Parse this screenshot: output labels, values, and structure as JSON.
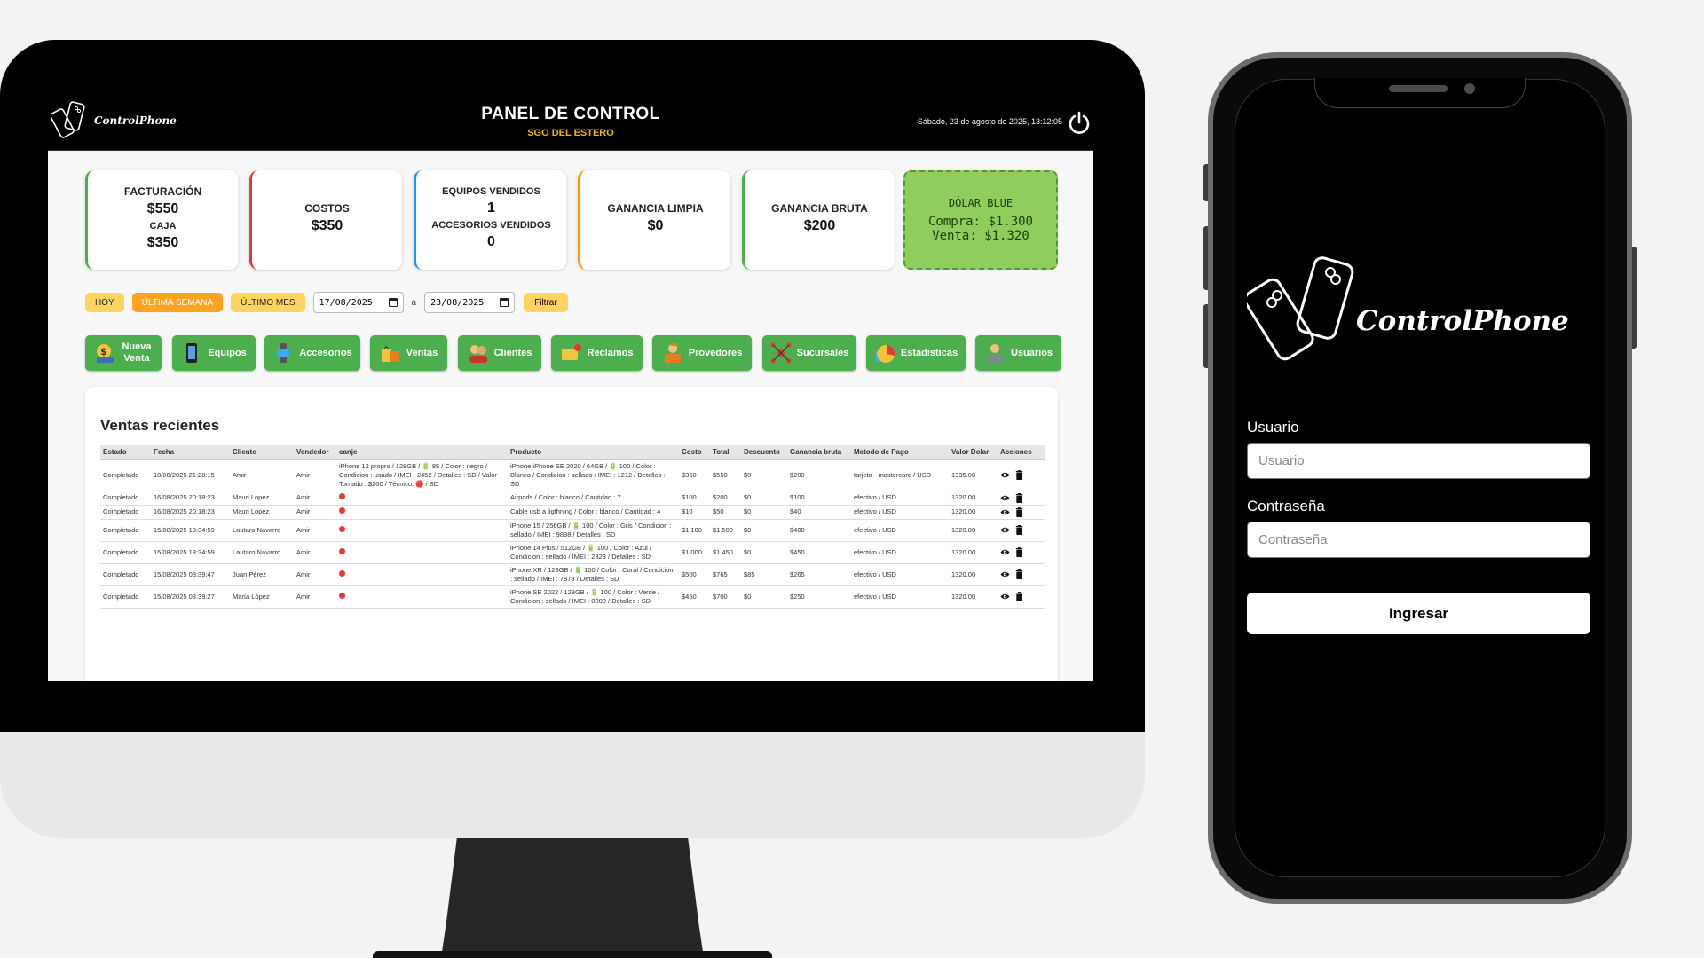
{
  "dashboard": {
    "brand": "ControlPhone",
    "title": "PANEL DE CONTROL",
    "subtitle": "SGO DEL ESTERO",
    "datetime": "Sábado, 23 de agosto de 2025, 13:12:05",
    "stats": {
      "facturacion_label": "FACTURACIÓN",
      "facturacion_value": "$550",
      "caja_label": "CAJA",
      "caja_value": "$350",
      "costos_label": "COSTOS",
      "costos_value": "$350",
      "equipos_label": "EQUIPOS VENDIDOS",
      "equipos_value": "1",
      "accesorios_label": "ACCESORIOS VENDIDOS",
      "accesorios_value": "0",
      "limpia_label": "GANANCIA LIMPIA",
      "limpia_value": "$0",
      "bruta_label": "GANANCIA BRUTA",
      "bruta_value": "$200"
    },
    "dolar": {
      "title": "DÓLAR BLUE",
      "compra": "Compra: $1.300",
      "venta": "Venta: $1.320"
    },
    "filters": {
      "hoy": "HOY",
      "semana": "ÚLTIMA SEMANA",
      "mes": "ÚLTIMO MES",
      "from": "17/08/2025",
      "sep": "a",
      "to": "23/08/2025",
      "filtrar": "Filtrar"
    },
    "nav": {
      "nueva_1": "Nueva",
      "nueva_2": "Venta",
      "equipos": "Equipos",
      "accesorios": "Accesorios",
      "ventas": "Ventas",
      "clientes": "Clientes",
      "reclamos": "Reclamos",
      "proveedores": "Provedores",
      "sucursales": "Sucursales",
      "estadisticas": "Estadisticas",
      "usuarios": "Usuarios"
    },
    "sales_title": "Ventas recientes",
    "columns": [
      "Estado",
      "Fecha",
      "Cliente",
      "Vendedor",
      "canje",
      "Producto",
      "Costo",
      "Total",
      "Descuento",
      "Ganancia bruta",
      "Metodo de Pago",
      "Valor Dolar",
      "Acciones"
    ],
    "rows": [
      [
        "Completado",
        "18/08/2025 21:28:15",
        "Amir",
        "Amir",
        "iPhone 12 propro / 128GB / 🔋 85 / Color : negro / Condicion : usado / IMEI : 2452 / Detalles : SD / Valor Tomado : $200 / Técnico: 🔴 / SD",
        "iPhone iPhone SE 2020 / 64GB / 🔋 100 / Color : Blanco / Condicion : sellado / IMEI : 1212 / Detalles : SD",
        "$350",
        "$550",
        "$0",
        "$200",
        "tarjeta - mastercard / USD",
        "1335.00"
      ],
      [
        "Completado",
        "16/08/2025 20:18:23",
        "Mauri Lopez",
        "Amir",
        "",
        "Airpods / Color : blanco / Cantidad : 7",
        "$100",
        "$200",
        "$0",
        "$100",
        "efectivo / USD",
        "1320.00"
      ],
      [
        "Completado",
        "16/08/2025 20:18:23",
        "Mauri Lopez",
        "Amir",
        "",
        "Cable usb a ligthning / Color : blanco / Cantidad : 4",
        "$10",
        "$50",
        "$0",
        "$40",
        "efectivo / USD",
        "1320.00"
      ],
      [
        "Completado",
        "15/08/2025 13:34:59",
        "Lautaro Navarro",
        "Amir",
        "",
        "iPhone 15 / 256GB / 🔋 100 / Color : Gris / Condicion : sellado / IMEI : 9898 / Detalles : SD",
        "$1.100",
        "$1.500",
        "$0",
        "$400",
        "efectivo / USD",
        "1320.00"
      ],
      [
        "Completado",
        "15/08/2025 13:34:59",
        "Lautaro Navarro",
        "Amir",
        "",
        "iPhone 14 Plus / 512GB / 🔋 100 / Color : Azul / Condicion : sellado / IMEI : 2323 / Detalles : SD",
        "$1.000",
        "$1.450",
        "$0",
        "$450",
        "efectivo / USD",
        "1320.00"
      ],
      [
        "Completado",
        "15/08/2025 03:39:47",
        "Juan Pérez",
        "Amir",
        "",
        "iPhone XR / 128GB / 🔋 100 / Color : Coral / Condicion : sellado / IMEI : 7878 / Detalles : SD",
        "$500",
        "$765",
        "$85",
        "$265",
        "efectivo / USD",
        "1320.00"
      ],
      [
        "Completado",
        "15/08/2025 03:39:27",
        "María López",
        "Amir",
        "",
        "iPhone SE 2022 / 128GB / 🔋 100 / Color : Verde / Condicion : sellado / IMEI : 0000 / Detalles : SD",
        "$450",
        "$700",
        "$0",
        "$250",
        "efectivo / USD",
        "1320.00"
      ]
    ]
  },
  "login": {
    "brand": "ControlPhone",
    "user_label": "Usuario",
    "user_placeholder": "Usuario",
    "pass_label": "Contraseña",
    "pass_placeholder": "Contraseña",
    "submit": "Ingresar"
  },
  "colors": {
    "accent_green": "#4cae4c",
    "accent_yellow": "#ffd361",
    "accent_orange": "#ffa320",
    "subtitle_gold": "#f3b211",
    "card_facturacion": "#4cae4c",
    "card_costos": "#e53935",
    "card_equipos": "#2196f3",
    "card_limpia": "#ff9800",
    "card_bruta": "#4caf50",
    "dolar_bg": "#8fce5c"
  },
  "icons": {
    "brand": "phones-icon",
    "power": "power-icon",
    "calendar": "calendar-icon",
    "view": "eye-icon",
    "delete": "trash-icon",
    "canje_marker": "red-dot-icon"
  }
}
